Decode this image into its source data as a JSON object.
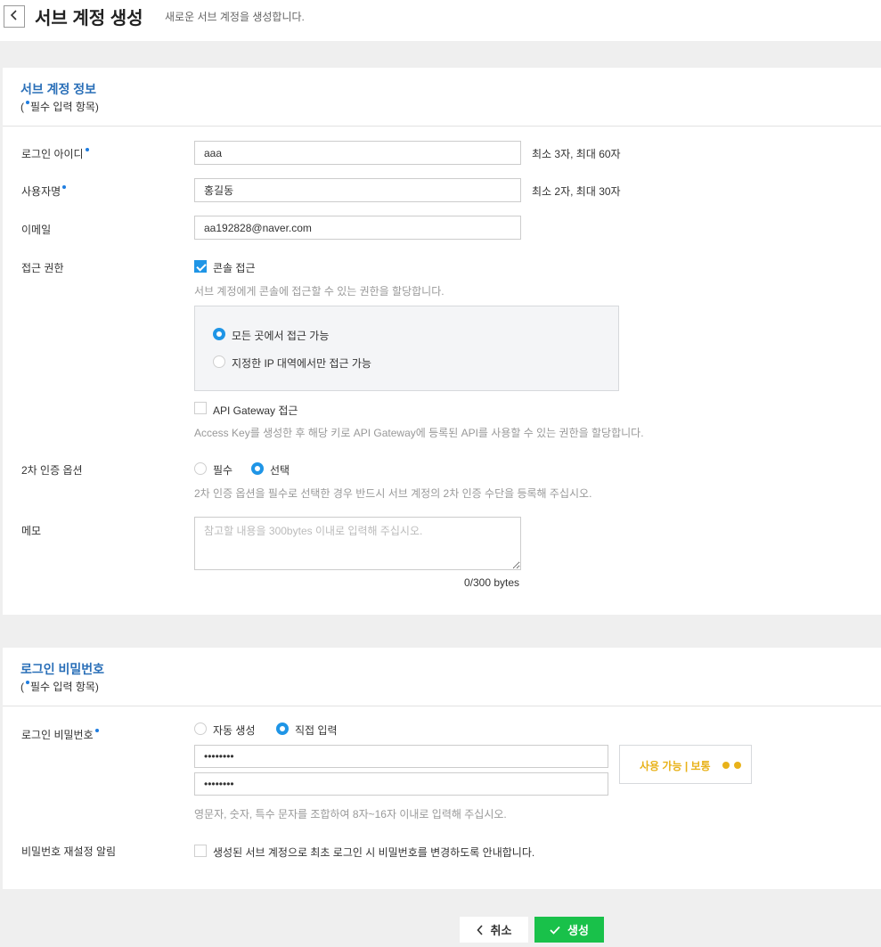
{
  "header": {
    "back_icon": "chevron-left-icon",
    "title": "서브 계정 생성",
    "subtitle": "새로운 서브 계정을 생성합니다."
  },
  "account_info": {
    "title": "서브 계정 정보",
    "required_prefix": "(",
    "required_text": "필수 입력 항목)",
    "login_id": {
      "label": "로그인 아이디",
      "required": true,
      "value": "aaa",
      "hint": "최소 3자, 최대 60자"
    },
    "username": {
      "label": "사용자명",
      "required": true,
      "value": "홍길동",
      "hint": "최소 2자, 최대 30자"
    },
    "email": {
      "label": "이메일",
      "value": "aa192828@naver.com"
    },
    "access": {
      "label": "접근 권한",
      "console_label": "콘솔 접근",
      "console_checked": true,
      "console_help": "서브 계정에게 콘솔에 접근할 수 있는 권한을 할당합니다.",
      "options": [
        {
          "label": "모든 곳에서 접근 가능",
          "checked": true
        },
        {
          "label": "지정한 IP 대역에서만 접근 가능",
          "checked": false
        }
      ],
      "api_label": "API Gateway 접근",
      "api_checked": false,
      "api_help": "Access Key를 생성한 후 해당 키로 API Gateway에 등록된 API를 사용할 수 있는 권한을 할당합니다."
    },
    "two_factor": {
      "label": "2차 인증 옵션",
      "options": [
        {
          "label": "필수",
          "checked": false
        },
        {
          "label": "선택",
          "checked": true
        }
      ],
      "help": "2차 인증 옵션을 필수로 선택한 경우 반드시 서브 계정의 2차 인증 수단을 등록해 주십시오."
    },
    "memo": {
      "label": "메모",
      "placeholder": "참고할 내용을 300bytes 이내로 입력해 주십시오.",
      "counter": "0/300 bytes"
    }
  },
  "password": {
    "title": "로그인 비밀번호",
    "required_prefix": "(",
    "required_text": "필수 입력 항목)",
    "label": "로그인 비밀번호",
    "required": true,
    "options": [
      {
        "label": "자동 생성",
        "checked": false
      },
      {
        "label": "직접 입력",
        "checked": true
      }
    ],
    "password_value": "••••••••",
    "confirm_value": "••••••••",
    "strength_text": "사용 가능 | 보통",
    "strength_color": "#e8b21a",
    "help": "영문자, 숫자, 특수 문자를 조합하여 8자~16자 이내로 입력해 주십시오.",
    "reset_label": "비밀번호 재설정 알림",
    "reset_text": "생성된 서브 계정으로 최초 로그인 시 비밀번호를 변경하도록 안내합니다.",
    "reset_checked": false
  },
  "footer": {
    "cancel_label": "취소",
    "cancel_icon": "chevron-left-icon",
    "create_label": "생성",
    "create_icon": "check-icon",
    "create_color": "#19c14a"
  }
}
